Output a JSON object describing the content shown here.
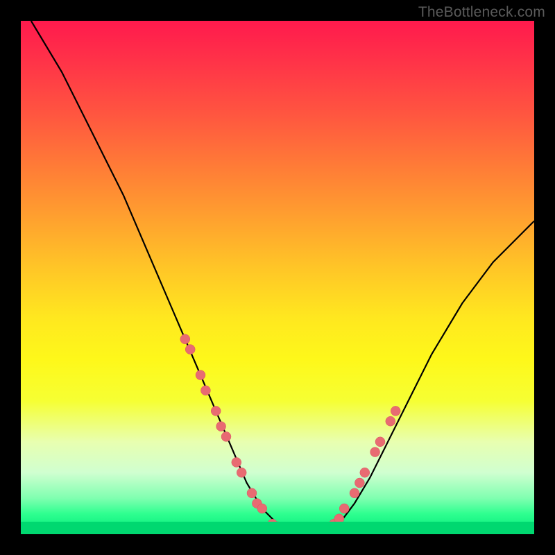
{
  "watermark": "TheBottleneck.com",
  "chart_data": {
    "type": "line",
    "title": "",
    "xlabel": "",
    "ylabel": "",
    "xlim": [
      0,
      100
    ],
    "ylim": [
      0,
      100
    ],
    "grid": false,
    "legend": false,
    "series": [
      {
        "name": "bottleneck-curve",
        "x": [
          2,
          5,
          8,
          11,
          14,
          17,
          20,
          23,
          26,
          29,
          32,
          35,
          38,
          41,
          44,
          47,
          50,
          53,
          56,
          59,
          62,
          65,
          68,
          71,
          74,
          77,
          80,
          83,
          86,
          89,
          92,
          95,
          98,
          100
        ],
        "values": [
          100,
          95,
          90,
          84,
          78,
          72,
          66,
          59,
          52,
          45,
          38,
          31,
          24,
          17,
          10,
          5,
          2,
          0,
          0,
          0,
          2,
          6,
          11,
          17,
          23,
          29,
          35,
          40,
          45,
          49,
          53,
          56,
          59,
          61
        ]
      }
    ],
    "data_points": [
      {
        "x": 32,
        "y": 38
      },
      {
        "x": 33,
        "y": 36
      },
      {
        "x": 35,
        "y": 31
      },
      {
        "x": 36,
        "y": 28
      },
      {
        "x": 38,
        "y": 24
      },
      {
        "x": 39,
        "y": 21
      },
      {
        "x": 40,
        "y": 19
      },
      {
        "x": 42,
        "y": 14
      },
      {
        "x": 43,
        "y": 12
      },
      {
        "x": 45,
        "y": 8
      },
      {
        "x": 46,
        "y": 6
      },
      {
        "x": 47,
        "y": 5
      },
      {
        "x": 49,
        "y": 2
      },
      {
        "x": 50,
        "y": 1.5
      },
      {
        "x": 52,
        "y": 0.5
      },
      {
        "x": 53,
        "y": 0
      },
      {
        "x": 55,
        "y": 0
      },
      {
        "x": 56,
        "y": 0
      },
      {
        "x": 58,
        "y": 0
      },
      {
        "x": 59,
        "y": 0.5
      },
      {
        "x": 61,
        "y": 2
      },
      {
        "x": 62,
        "y": 3
      },
      {
        "x": 63,
        "y": 5
      },
      {
        "x": 65,
        "y": 8
      },
      {
        "x": 66,
        "y": 10
      },
      {
        "x": 67,
        "y": 12
      },
      {
        "x": 69,
        "y": 16
      },
      {
        "x": 70,
        "y": 18
      },
      {
        "x": 72,
        "y": 22
      },
      {
        "x": 73,
        "y": 24
      }
    ],
    "gradient_stops": [
      {
        "pos": 0,
        "color": "#ff1a4d"
      },
      {
        "pos": 50,
        "color": "#ffe81f"
      },
      {
        "pos": 100,
        "color": "#00d870"
      }
    ]
  }
}
